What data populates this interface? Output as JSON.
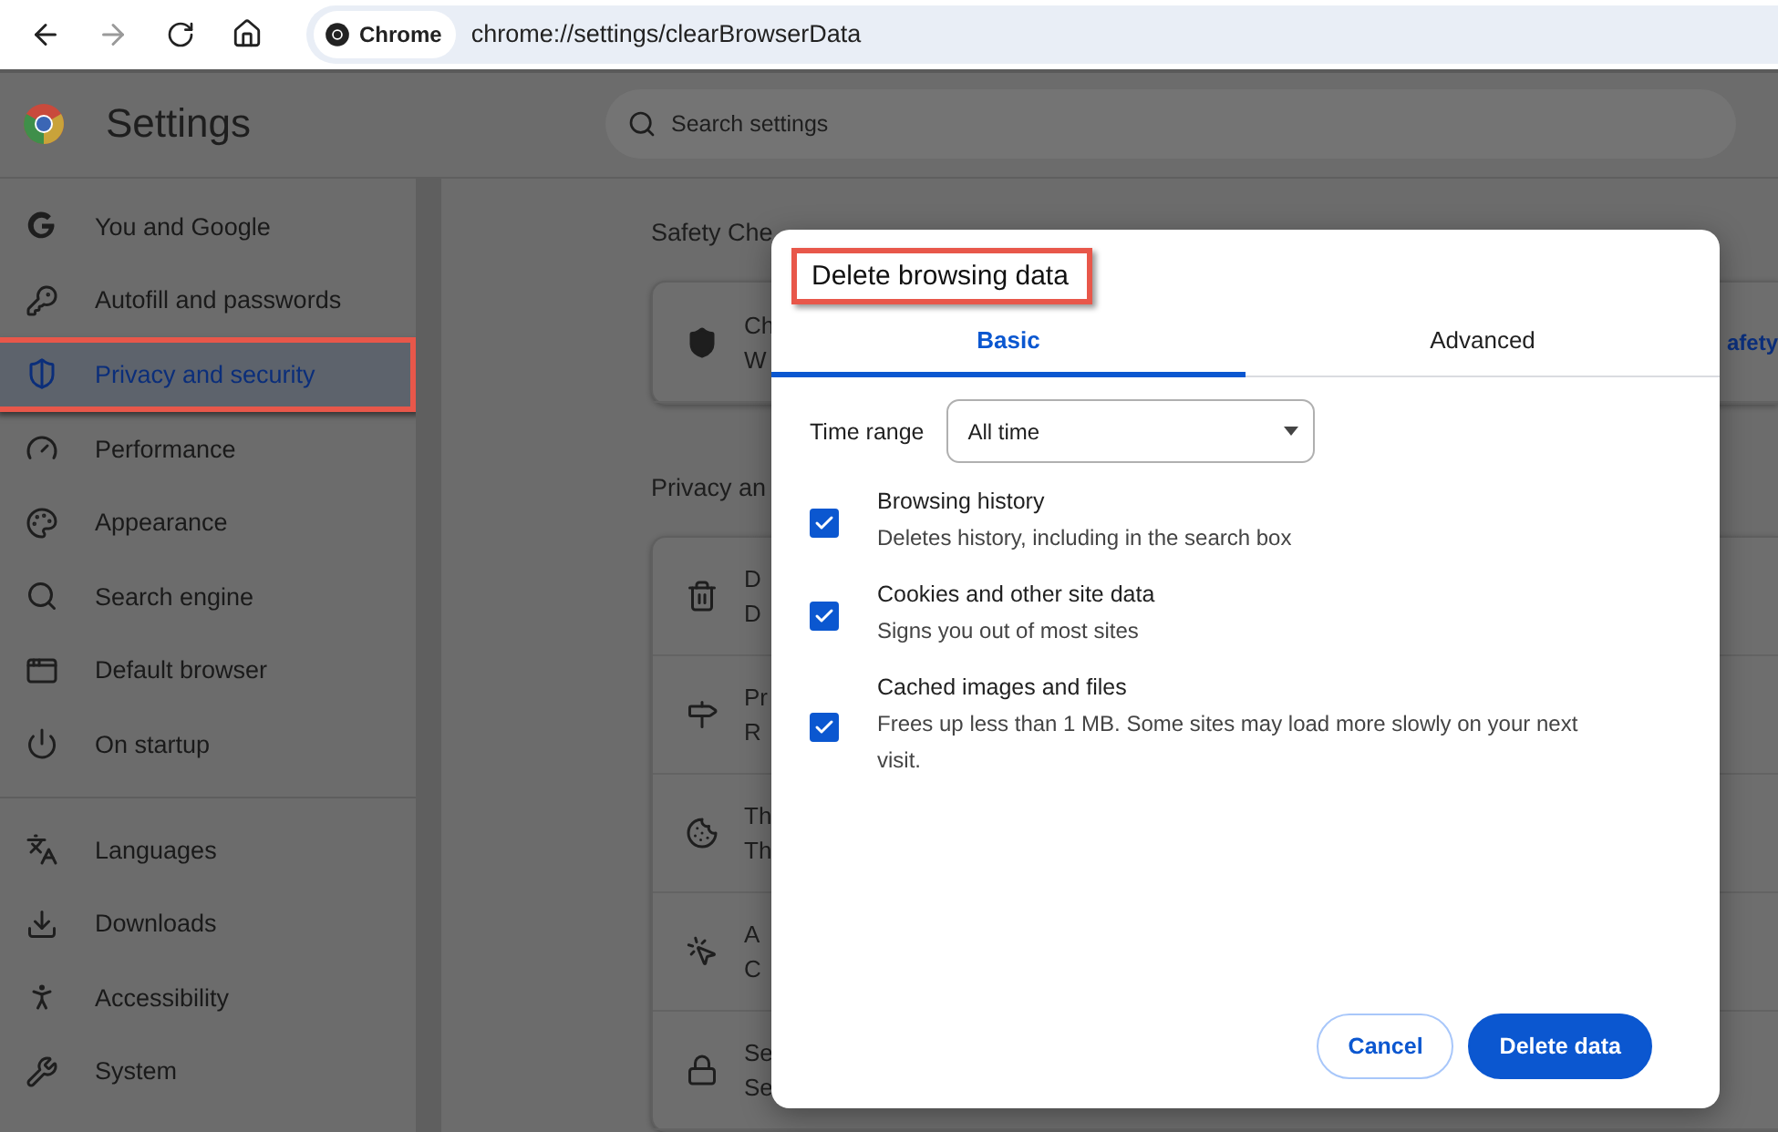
{
  "toolbar": {
    "chip": "Chrome",
    "url": "chrome://settings/clearBrowserData"
  },
  "header": {
    "title": "Settings",
    "search_placeholder": "Search settings"
  },
  "sidebar": {
    "groups": [
      [
        {
          "label": "You and Google",
          "selected": false,
          "annotated": false
        },
        {
          "label": "Autofill and passwords",
          "selected": false,
          "annotated": false
        },
        {
          "label": "Privacy and security",
          "selected": true,
          "annotated": true
        },
        {
          "label": "Performance",
          "selected": false,
          "annotated": false
        },
        {
          "label": "Appearance",
          "selected": false,
          "annotated": false
        },
        {
          "label": "Search engine",
          "selected": false,
          "annotated": false
        },
        {
          "label": "Default browser",
          "selected": false,
          "annotated": false
        },
        {
          "label": "On startup",
          "selected": false,
          "annotated": false
        }
      ],
      [
        {
          "label": "Languages",
          "selected": false,
          "annotated": false
        },
        {
          "label": "Downloads",
          "selected": false,
          "annotated": false
        },
        {
          "label": "Accessibility",
          "selected": false,
          "annotated": false
        },
        {
          "label": "System",
          "selected": false,
          "annotated": false
        }
      ]
    ]
  },
  "main": {
    "safety_heading": "Safety Che",
    "safety_card": {
      "line_1": "Ch",
      "line_2": "W",
      "link": "afety"
    },
    "privacy_heading": "Privacy an",
    "privacy_rows": [
      {
        "line_1": "D",
        "line_2": "D"
      },
      {
        "line_1": "Pr",
        "line_2": "R"
      },
      {
        "line_1": "Th",
        "line_2": "Th"
      },
      {
        "line_1": "A",
        "line_2": "C"
      },
      {
        "line_1": "Se",
        "line_2": "Se"
      }
    ]
  },
  "dialog": {
    "title": "Delete browsing data",
    "title_annotated": true,
    "tabs": [
      {
        "label": "Basic",
        "selected": true
      },
      {
        "label": "Advanced",
        "selected": false
      }
    ],
    "time_range": {
      "label": "Time range",
      "value": "All time"
    },
    "options": [
      {
        "title": "Browsing history",
        "description": "Deletes history, including in the search box",
        "checked": true
      },
      {
        "title": "Cookies and other site data",
        "description": "Signs you out of most sites",
        "checked": true
      },
      {
        "title": "Cached images and files",
        "description": "Frees up less than 1 MB. Some sites may load more slowly on your next visit.",
        "checked": true
      }
    ],
    "buttons": [
      {
        "label": "Cancel",
        "kind": "secondary"
      },
      {
        "label": "Delete data",
        "kind": "primary"
      }
    ]
  }
}
